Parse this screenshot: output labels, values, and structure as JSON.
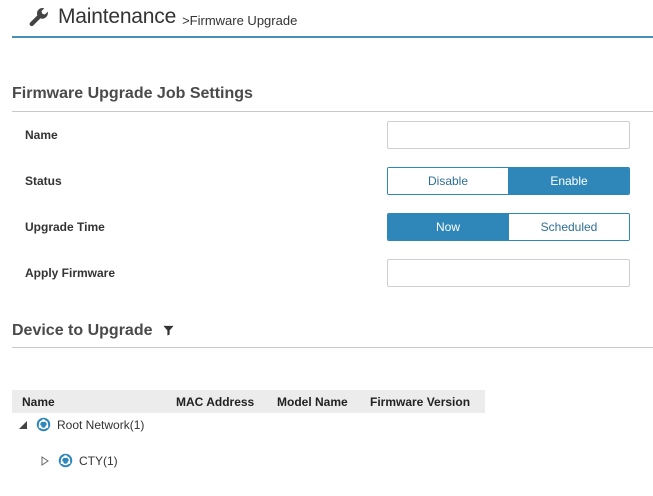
{
  "header": {
    "title": "Maintenance",
    "breadcrumb": ">Firmware Upgrade",
    "icon": "wrench-icon"
  },
  "job_settings": {
    "section_title": "Firmware Upgrade Job Settings",
    "name_label": "Name",
    "name_value": "",
    "status_label": "Status",
    "status_options": [
      "Disable",
      "Enable"
    ],
    "status_selected": "Enable",
    "upgrade_time_label": "Upgrade Time",
    "upgrade_time_options": [
      "Now",
      "Scheduled"
    ],
    "upgrade_time_selected": "Now",
    "apply_firmware_label": "Apply Firmware",
    "apply_firmware_value": ""
  },
  "device_section": {
    "section_title": "Device to Upgrade",
    "filter_icon": "filter-icon",
    "columns": [
      "Name",
      "MAC Address",
      "Model Name",
      "Firmware Version"
    ],
    "tree": [
      {
        "label": "Root Network(1)",
        "expanded": true,
        "icon": "network-icon"
      },
      {
        "label": "CTY(1)",
        "expanded": false,
        "icon": "network-icon"
      }
    ]
  },
  "colors": {
    "accent": "#2f87b9",
    "header_rule": "#4a8fb4"
  }
}
